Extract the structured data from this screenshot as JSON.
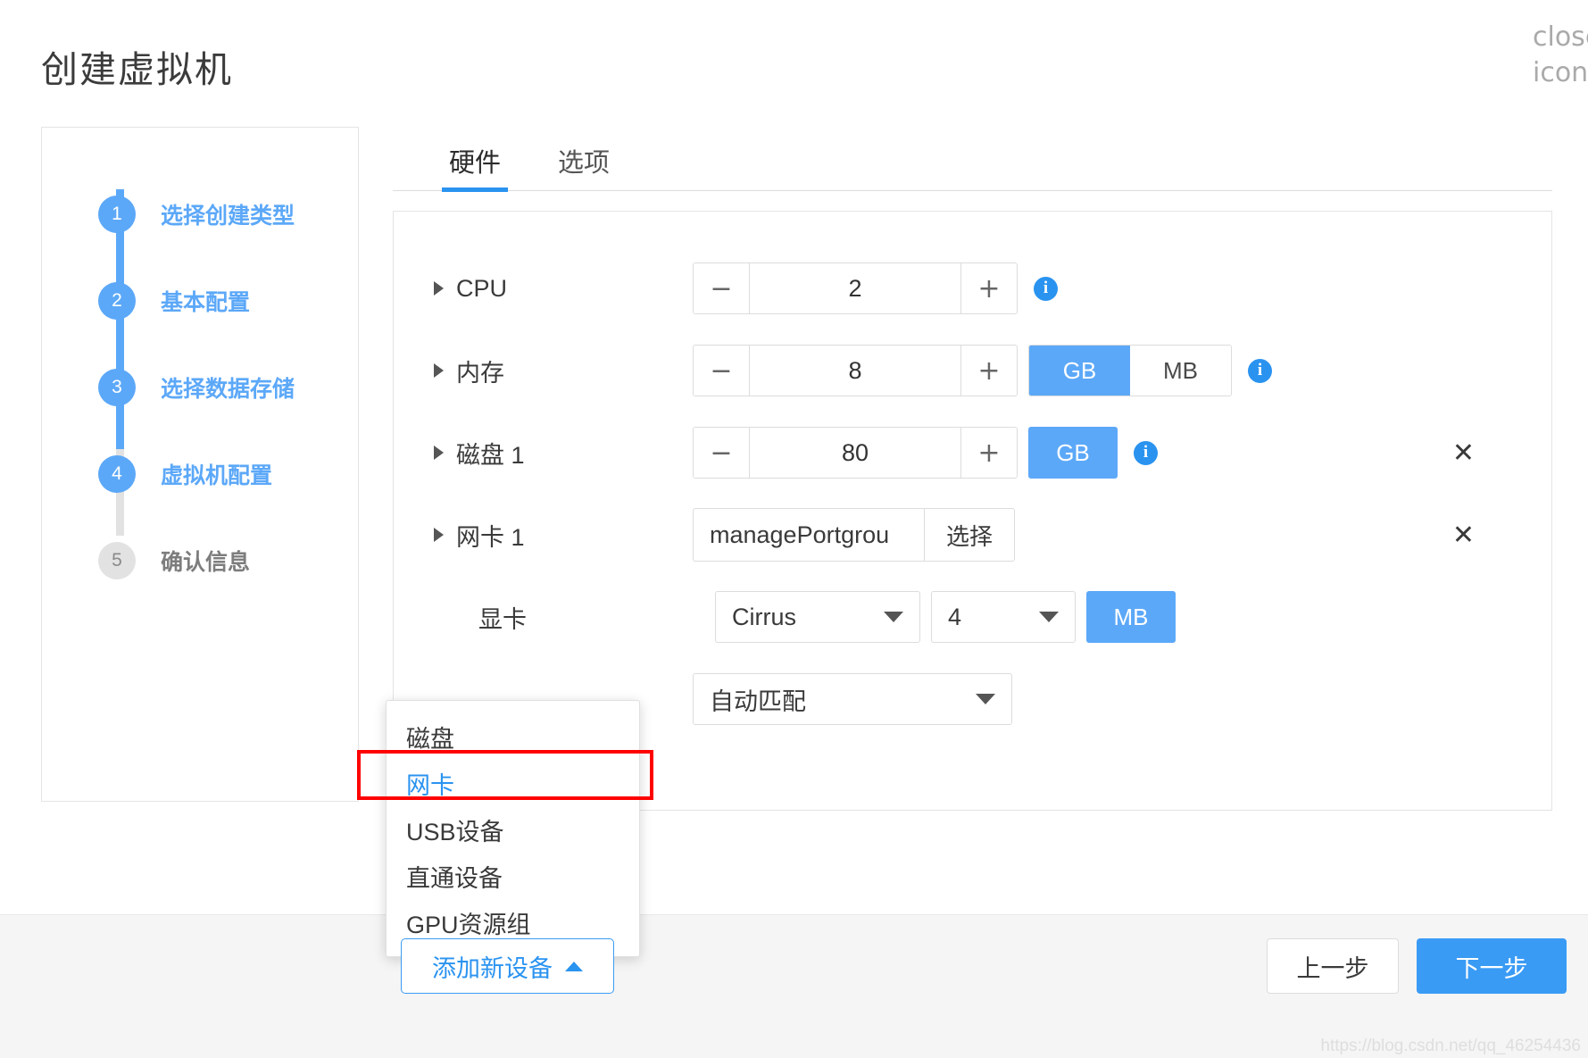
{
  "dialog": {
    "title": "创建虚拟机",
    "close_icon": "close-icon"
  },
  "steps": [
    {
      "num": "1",
      "label": "选择创建类型",
      "state": "active"
    },
    {
      "num": "2",
      "label": "基本配置",
      "state": "active"
    },
    {
      "num": "3",
      "label": "选择数据存储",
      "state": "active"
    },
    {
      "num": "4",
      "label": "虚拟机配置",
      "state": "active"
    },
    {
      "num": "5",
      "label": "确认信息",
      "state": "inactive"
    }
  ],
  "tabs": [
    {
      "label": "硬件",
      "active": true
    },
    {
      "label": "选项",
      "active": false
    }
  ],
  "hardware": {
    "cpu": {
      "label": "CPU",
      "value": "2",
      "minus": "−",
      "plus": "+",
      "info": "i"
    },
    "memory": {
      "label": "内存",
      "value": "8",
      "minus": "−",
      "plus": "+",
      "units": [
        {
          "label": "GB",
          "active": true
        },
        {
          "label": "MB",
          "active": false
        }
      ],
      "info": "i"
    },
    "disk1": {
      "label": "磁盘 1",
      "value": "80",
      "minus": "−",
      "plus": "+",
      "unit": "GB",
      "info": "i",
      "remove": "✕"
    },
    "nic1": {
      "label": "网卡 1",
      "value": "managePortgrou",
      "pick_label": "选择",
      "remove": "✕"
    },
    "gpu": {
      "label": "显卡",
      "model": "Cirrus",
      "vram": "4",
      "unit": "MB"
    },
    "mode": {
      "value": "自动匹配"
    }
  },
  "add_menu": {
    "items": [
      {
        "label": "磁盘",
        "highlight": false
      },
      {
        "label": "网卡",
        "highlight": true
      },
      {
        "label": "USB设备",
        "highlight": false
      },
      {
        "label": "直通设备",
        "highlight": false
      },
      {
        "label": "GPU资源组",
        "highlight": false
      }
    ]
  },
  "footer": {
    "add_device": "添加新设备",
    "prev": "上一步",
    "next": "下一步"
  },
  "watermark": "https://blog.csdn.net/qq_46254436",
  "colors": {
    "accent": "#5ca8f8",
    "accent_strong": "#3a9bf5",
    "annotation": "#ff0000",
    "inactive": "#e2e2e2"
  }
}
